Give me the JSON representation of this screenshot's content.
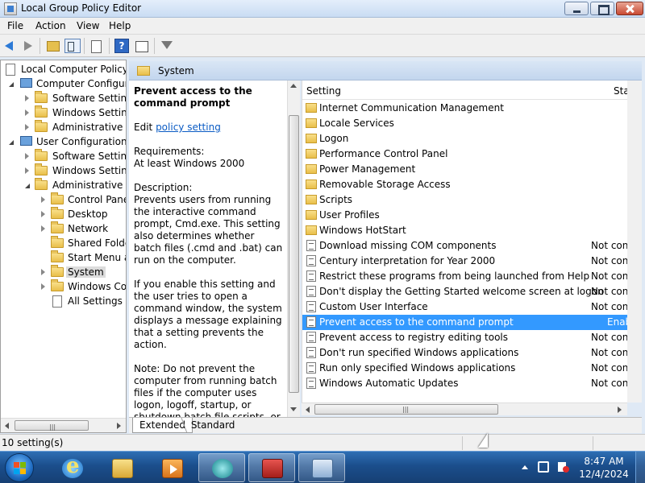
{
  "window": {
    "title": "Local Group Policy Editor"
  },
  "menu": [
    "File",
    "Action",
    "View",
    "Help"
  ],
  "toolbar": {
    "icons": [
      "back-icon",
      "forward-icon",
      "up-folder-icon",
      "show-hide-tree-icon",
      "export-list-icon",
      "help-icon",
      "view-icon",
      "filter-icon"
    ],
    "help_glyph": "?"
  },
  "tree": {
    "root": "Local Computer Policy",
    "items": [
      "Computer Configura",
      "Software Settings",
      "Windows Setting",
      "Administrative Te",
      "User Configuration",
      "Software Settings",
      "Windows Setting",
      "Administrative Te",
      "Control Panel",
      "Desktop",
      "Network",
      "Shared Folder",
      "Start Menu ar",
      "System",
      "Windows Cor",
      "All Settings"
    ],
    "scroll_grip": "|||"
  },
  "pane": {
    "header": "System"
  },
  "description": {
    "title": "Prevent access to the command prompt",
    "edit_prefix": "Edit ",
    "edit_link": "policy setting",
    "requirements_label": "Requirements:",
    "requirements_value": "At least Windows 2000",
    "description_label": "Description:",
    "description_text": "Prevents users from running the interactive command prompt, Cmd.exe. This setting also determines whether batch files (.cmd and .bat) can run on the computer.",
    "paragraph2": "If you enable this setting and the user tries to open a command window, the system displays a message explaining that a setting prevents the action.",
    "paragraph3": "Note: Do not prevent the computer from running batch files if the computer uses logon, logoff, startup, or shutdown batch file scripts, or for users that use"
  },
  "list": {
    "col_setting": "Setting",
    "col_state": "Sta",
    "rows": [
      {
        "name": "Internet Communication Management",
        "state": "",
        "type": "folder"
      },
      {
        "name": "Locale Services",
        "state": "",
        "type": "folder"
      },
      {
        "name": "Logon",
        "state": "",
        "type": "folder"
      },
      {
        "name": "Performance Control Panel",
        "state": "",
        "type": "folder"
      },
      {
        "name": "Power Management",
        "state": "",
        "type": "folder"
      },
      {
        "name": "Removable Storage Access",
        "state": "",
        "type": "folder"
      },
      {
        "name": "Scripts",
        "state": "",
        "type": "folder"
      },
      {
        "name": "User Profiles",
        "state": "",
        "type": "folder"
      },
      {
        "name": "Windows HotStart",
        "state": "",
        "type": "folder"
      },
      {
        "name": "Download missing COM components",
        "state": "Not conf",
        "type": "setting"
      },
      {
        "name": "Century interpretation for Year 2000",
        "state": "Not conf",
        "type": "setting"
      },
      {
        "name": "Restrict these programs from being launched from Help",
        "state": "Not conf",
        "type": "setting"
      },
      {
        "name": "Don't display the Getting Started welcome screen at logon",
        "state": "Not conf",
        "type": "setting"
      },
      {
        "name": "Custom User Interface",
        "state": "Not conf",
        "type": "setting"
      },
      {
        "name": "Prevent access to the command prompt",
        "state": "Enab",
        "type": "setting",
        "selected": true
      },
      {
        "name": "Prevent access to registry editing tools",
        "state": "Not conf",
        "type": "setting"
      },
      {
        "name": "Don't run specified Windows applications",
        "state": "Not conf",
        "type": "setting"
      },
      {
        "name": "Run only specified Windows applications",
        "state": "Not conf",
        "type": "setting"
      },
      {
        "name": "Windows Automatic Updates",
        "state": "Not conf",
        "type": "setting"
      }
    ],
    "scroll_grip": "|||"
  },
  "tabs": {
    "extended": "Extended",
    "standard": "Standard"
  },
  "status": {
    "text": "10 setting(s)"
  },
  "taskbar": {
    "apps": [
      "internet-explorer-icon",
      "windows-explorer-icon",
      "media-player-icon",
      "app-icon",
      "toolbox-icon",
      "group-policy-icon"
    ],
    "time": "8:47 AM",
    "date": "12/4/2024"
  }
}
